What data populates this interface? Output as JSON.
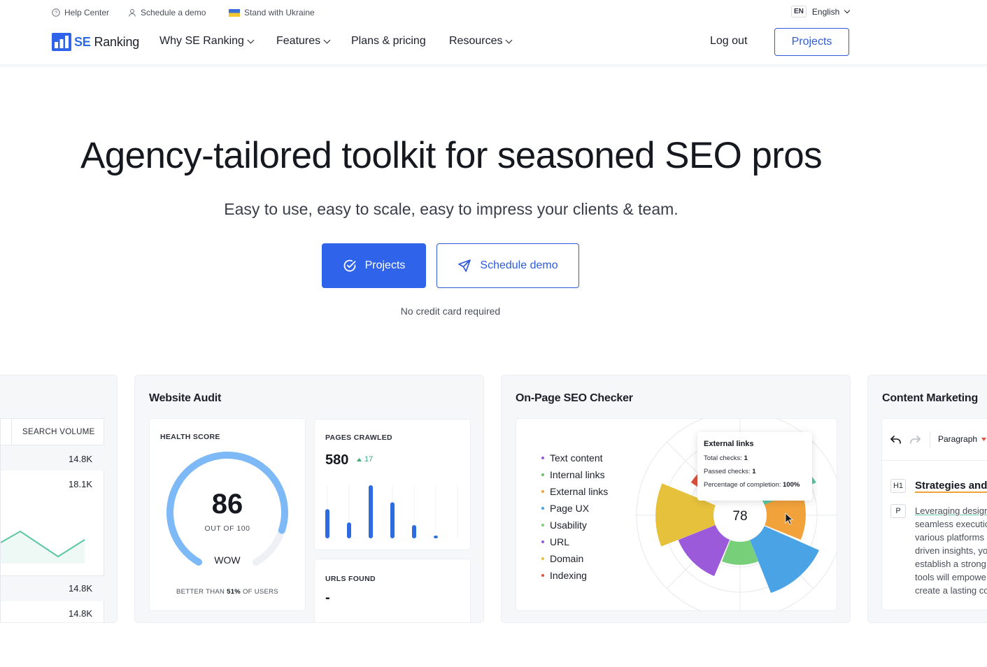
{
  "utility": {
    "help": "Help Center",
    "demo": "Schedule a demo",
    "ukraine": "Stand with Ukraine",
    "lang_code": "EN",
    "lang_name": "English"
  },
  "nav": {
    "logo_se": "SE",
    "logo_ranking": "Ranking",
    "links": [
      "Why SE Ranking",
      "Features",
      "Plans & pricing",
      "Resources"
    ],
    "logout": "Log out",
    "projects": "Projects"
  },
  "hero": {
    "title": "Agency-tailored toolkit for seasoned SEO pros",
    "subtitle": "Easy to use, easy to scale, easy to impress your clients & team.",
    "cta_primary": "Projects",
    "cta_secondary": "Schedule demo",
    "note": "No credit card required"
  },
  "keyword_card": {
    "column": "SEARCH VOLUME",
    "values": [
      "14.8K",
      "18.1K",
      "14.8K",
      "14.8K"
    ]
  },
  "audit": {
    "title": "Website Audit",
    "health_label": "HEALTH SCORE",
    "score": "86",
    "out_of": "OUT OF 100",
    "grade": "WOW",
    "better_prefix": "BETTER THAN",
    "better_value": "51%",
    "better_suffix": "OF USERS",
    "health_fraction": 0.86,
    "pages_label": "PAGES CRAWLED",
    "pages_value": "580",
    "pages_delta": "17",
    "pages_bars": [
      0.55,
      0.3,
      1.0,
      0.68,
      0.25,
      0.05
    ],
    "urls_label": "URLS FOUND",
    "urls_value": "-"
  },
  "checker": {
    "title": "On-Page SEO Checker",
    "legend": [
      {
        "label": "Text content",
        "color": "#9b59d9"
      },
      {
        "label": "Internal links",
        "color": "#6cc070"
      },
      {
        "label": "External links",
        "color": "#f0a33a"
      },
      {
        "label": "Page UX",
        "color": "#47a3e6"
      },
      {
        "label": "Usability",
        "color": "#7ccf7f"
      },
      {
        "label": "URL",
        "color": "#9b59d9"
      },
      {
        "label": "Domain",
        "color": "#e8c23a"
      },
      {
        "label": "Indexing",
        "color": "#e0503e"
      }
    ],
    "score": "78",
    "tooltip": {
      "title": "External links",
      "total_label": "Total checks:",
      "total_value": "1",
      "passed_label": "Passed checks:",
      "passed_value": "1",
      "pct_label": "Percentage of completion:",
      "pct_value": "100%"
    }
  },
  "content": {
    "title": "Content Marketing",
    "style": "Paragraph",
    "h1_tag": "H1",
    "p_tag": "P",
    "heading": "Strategies and",
    "lines": [
      "Leveraging design",
      "seamless executic",
      "various platforms",
      "driven insights, yo",
      "establish a strong",
      "tools will empowe",
      "create a lasting co"
    ]
  },
  "colors": {
    "brand": "#2f63e9",
    "gauge": "#7db9f7"
  }
}
